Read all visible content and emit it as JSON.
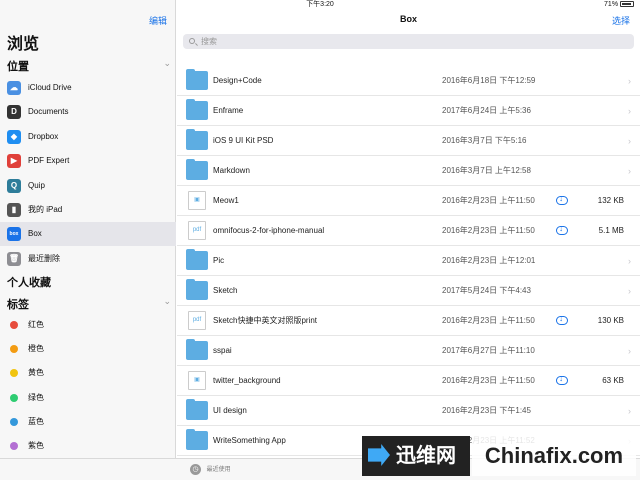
{
  "status": {
    "device": "iPad",
    "time": "下午3:20",
    "battery": "71%"
  },
  "sidebar": {
    "edit_label": "编辑",
    "title": "浏览",
    "locations_header": "位置",
    "locations": [
      {
        "label": "iCloud Drive",
        "icon": "icloud-icon",
        "color": "#4a90e2"
      },
      {
        "label": "Documents",
        "icon": "documents-app-icon",
        "color": "#333333"
      },
      {
        "label": "Dropbox",
        "icon": "dropbox-icon",
        "color": "#1f8ef1"
      },
      {
        "label": "PDF Expert",
        "icon": "pdf-expert-icon",
        "color": "#e0403a"
      },
      {
        "label": "Quip",
        "icon": "quip-icon",
        "color": "#2e7d9a"
      },
      {
        "label": "我的 iPad",
        "icon": "ipad-icon",
        "color": "#555555"
      },
      {
        "label": "Box",
        "icon": "box-icon",
        "color": "#1a73e8"
      },
      {
        "label": "最近删除",
        "icon": "trash-icon",
        "color": "#8e8e93"
      }
    ],
    "favorites_header": "个人收藏",
    "tags_header": "标签",
    "tags": [
      {
        "label": "红色",
        "color": "#e74c3c"
      },
      {
        "label": "橙色",
        "color": "#f39c12"
      },
      {
        "label": "黄色",
        "color": "#f1c40f"
      },
      {
        "label": "绿色",
        "color": "#2ecc71"
      },
      {
        "label": "蓝色",
        "color": "#3498db"
      },
      {
        "label": "紫色",
        "color": "#b36fd3"
      }
    ]
  },
  "main": {
    "title": "Box",
    "select_label": "选择",
    "search_placeholder": "搜索",
    "files": [
      {
        "name": "Design+Code",
        "date": "2016年6月18日 下午12:59",
        "kind": "folder",
        "size": ""
      },
      {
        "name": "Enframe",
        "date": "2017年6月24日 上午5:36",
        "kind": "folder",
        "size": ""
      },
      {
        "name": "iOS 9 UI Kit PSD",
        "date": "2016年3月7日 下午5:16",
        "kind": "folder",
        "size": ""
      },
      {
        "name": "Markdown",
        "date": "2016年3月7日 上午12:58",
        "kind": "folder",
        "size": ""
      },
      {
        "name": "Meow1",
        "date": "2016年2月23日 上午11:50",
        "kind": "file",
        "size": "132 KB"
      },
      {
        "name": "omnifocus-2-for-iphone-manual",
        "date": "2016年2月23日 上午11:50",
        "kind": "pdf",
        "size": "5.1 MB"
      },
      {
        "name": "Pic",
        "date": "2016年2月23日 上午12:01",
        "kind": "folder",
        "size": ""
      },
      {
        "name": "Sketch",
        "date": "2017年5月24日 下午4:43",
        "kind": "folder",
        "size": ""
      },
      {
        "name": "Sketch快捷中英文对照版print",
        "date": "2016年2月23日 上午11:50",
        "kind": "pdf",
        "size": "130 KB"
      },
      {
        "name": "sspai",
        "date": "2017年6月27日 上午11:10",
        "kind": "folder",
        "size": ""
      },
      {
        "name": "twitter_background",
        "date": "2016年2月23日 上午11:50",
        "kind": "file",
        "size": "63 KB"
      },
      {
        "name": "UI design",
        "date": "2016年2月23日 下午1:45",
        "kind": "folder",
        "size": ""
      },
      {
        "name": "WriteSomething App",
        "date": "2016年2月23日 上午11:52",
        "kind": "folder",
        "size": ""
      }
    ]
  },
  "bottom": {
    "recent_label": "最近使用"
  },
  "watermark": {
    "logo_text": "迅维网",
    "site_text": "Chinafix.com"
  },
  "colors": {
    "accent": "#1a73e8",
    "folder": "#5dade2"
  }
}
